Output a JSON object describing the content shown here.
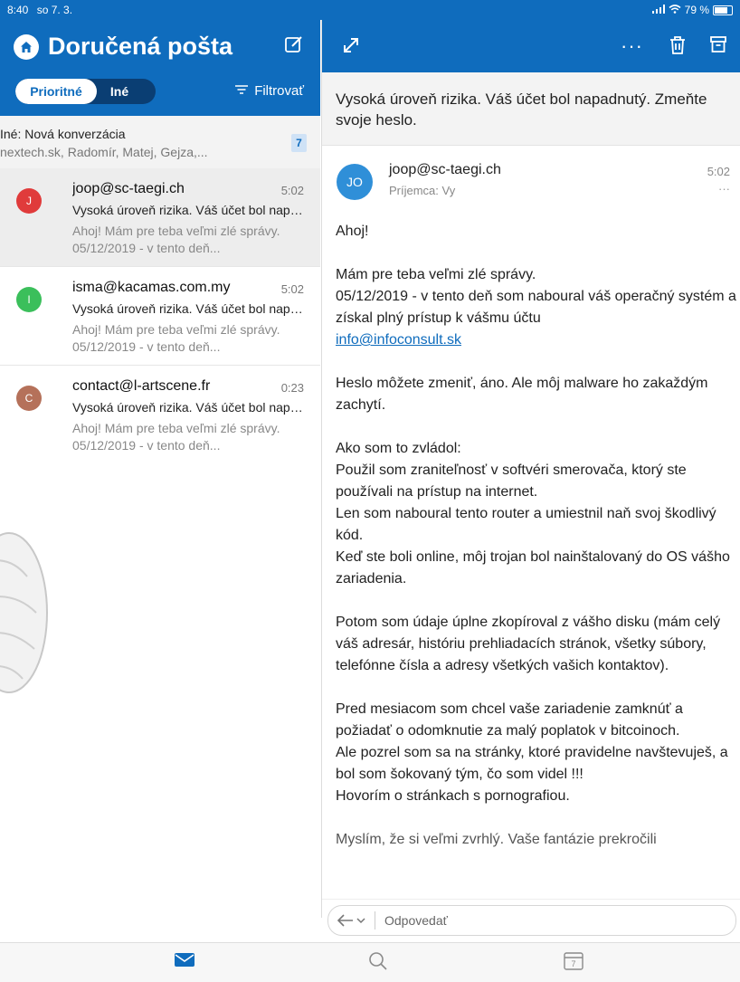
{
  "status_bar": {
    "time": "8:40",
    "date": "so 7. 3.",
    "battery": "79 %"
  },
  "left": {
    "title": "Doručená pošta",
    "tabs": {
      "focused": "Prioritné",
      "other": "Iné"
    },
    "filter_label": "Filtrovať",
    "other_conversation": {
      "title": "Iné: Nová konverzácia",
      "senders": "nextech.sk, Radomír, Matej, Gejza,...",
      "count": "7"
    },
    "messages": [
      {
        "initial": "J",
        "color": "#e03b3b",
        "sender": "joop@sc-taegi.ch",
        "time": "5:02",
        "subject": "Vysoká úroveň rizika. Váš účet bol napadnutý.",
        "preview": "Ahoj! Mám pre teba veľmi zlé správy. 05/12/2019 - v tento deň..."
      },
      {
        "initial": "I",
        "color": "#3bbf5b",
        "sender": "isma@kacamas.com.my",
        "time": "5:02",
        "subject": "Vysoká úroveň rizika. Váš účet bol napadnutý.",
        "preview": "Ahoj! Mám pre teba veľmi zlé správy. 05/12/2019 - v tento deň..."
      },
      {
        "initial": "C",
        "color": "#b5715a",
        "sender": "contact@l-artscene.fr",
        "time": "0:23",
        "subject": "Vysoká úroveň rizika. Váš účet bol napadnutý.",
        "preview": "Ahoj! Mám pre teba veľmi zlé správy. 05/12/2019 - v tento deň..."
      }
    ]
  },
  "right": {
    "subject": "Vysoká úroveň rizika. Váš účet bol napadnutý. Zmeňte svoje heslo.",
    "from": "joop@sc-taegi.ch",
    "from_initials": "JO",
    "to": "Príjemca: Vy",
    "time": "5:02",
    "more": "···",
    "body": {
      "greeting": "Ahoj!",
      "p1_line1": "Mám pre teba veľmi zlé správy.",
      "p1_line2": "05/12/2019 - v tento deň som naboural váš operačný systém a získal plný prístup k vášmu účtu",
      "p1_link": "info@infoconsult.sk",
      "p2": "Heslo môžete zmeniť, áno. Ale môj malware ho zakaždým zachytí.",
      "p3_line1": "Ako som to zvládol:",
      "p3_line2": "Použil som zraniteľnosť v softvéri smerovača, ktorý ste používali na prístup na internet.",
      "p3_line3": "Len som naboural tento router a umiestnil naň svoj škodlivý kód.",
      "p3_line4": "Keď ste boli online, môj trojan bol nainštalovaný do OS vášho zariadenia.",
      "p4": "Potom som údaje úplne zkopíroval z vášho disku (mám celý váš adresár, históriu prehliadacích stránok, všetky súbory, telefónne čísla a adresy všetkých vašich kontaktov).",
      "p5_line1": "Pred mesiacom som chcel vaše zariadenie zamknúť a požiadať o odomknutie za malý poplatok v bitcoinoch.",
      "p5_line2": "Ale pozrel som sa na stránky, ktoré pravidelne navštevuješ, a bol som šokovaný tým, čo som videl !!!",
      "p5_line3": "Hovorím o stránkach s pornografiou.",
      "p6_partial": "Myslím, že si veľmi zvrhlý. Vaše fantázie prekročili"
    },
    "reply_placeholder": "Odpovedať"
  },
  "tabbar": {
    "calendar_day": "7"
  }
}
